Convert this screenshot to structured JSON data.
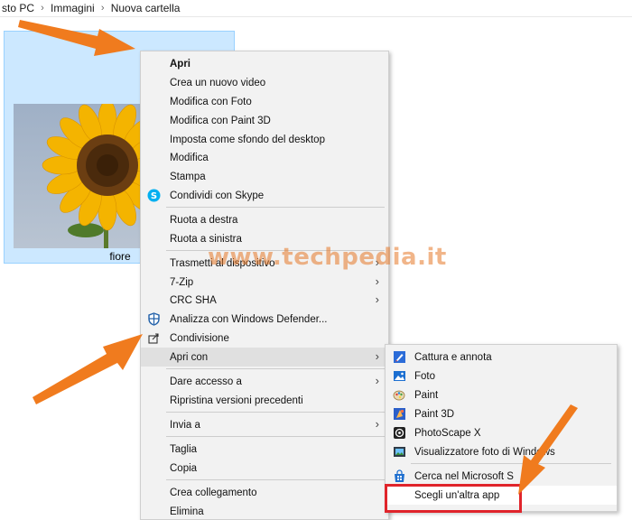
{
  "breadcrumb": {
    "items": [
      "sto PC",
      "Immagini",
      "Nuova cartella"
    ],
    "separator": "›"
  },
  "file": {
    "name": "fiore"
  },
  "context_menu": {
    "items": [
      {
        "label": "Apri",
        "bold": true
      },
      {
        "label": "Crea un nuovo video"
      },
      {
        "label": "Modifica con Foto"
      },
      {
        "label": "Modifica con Paint 3D"
      },
      {
        "label": "Imposta come sfondo del desktop"
      },
      {
        "label": "Modifica"
      },
      {
        "label": "Stampa"
      },
      {
        "label": "Condividi con Skype",
        "icon": "skype-icon"
      },
      {
        "label": "Ruota a destra"
      },
      {
        "label": "Ruota a sinistra"
      },
      {
        "label": "Trasmetti al dispositivo",
        "submenu": true
      },
      {
        "label": "7-Zip",
        "submenu": true
      },
      {
        "label": "CRC SHA",
        "submenu": true
      },
      {
        "label": "Analizza con Windows Defender...",
        "icon": "windows-defender-icon"
      },
      {
        "label": "Condivisione",
        "icon": "share-icon"
      },
      {
        "label": "Apri con",
        "submenu": true,
        "highlighted": true
      },
      {
        "label": "Dare accesso a",
        "submenu": true
      },
      {
        "label": "Ripristina versioni precedenti"
      },
      {
        "label": "Invia a",
        "submenu": true
      },
      {
        "label": "Taglia"
      },
      {
        "label": "Copia"
      },
      {
        "label": "Crea collegamento"
      },
      {
        "label": "Elimina"
      }
    ]
  },
  "open_with_submenu": {
    "items": [
      {
        "label": "Cattura e annota",
        "icon": "snip-sketch-icon"
      },
      {
        "label": "Foto",
        "icon": "photos-icon"
      },
      {
        "label": "Paint",
        "icon": "paint-icon"
      },
      {
        "label": "Paint 3D",
        "icon": "paint-3d-icon"
      },
      {
        "label": "PhotoScape X",
        "icon": "photoscape-icon"
      },
      {
        "label": "Visualizzatore foto di Windows",
        "icon": "windows-photo-viewer-icon"
      },
      {
        "label": "Cerca nel Microsoft S",
        "icon": "microsoft-store-icon"
      },
      {
        "label": "Scegli un'altra app",
        "highlighted": true
      }
    ]
  },
  "watermark": {
    "text": "www.techpedia.it"
  },
  "colors": {
    "selection_fill": "#cce8ff",
    "menu_background": "#f2f2f2",
    "arrow": "#f07b1e",
    "highlight_box": "#e0242b"
  }
}
